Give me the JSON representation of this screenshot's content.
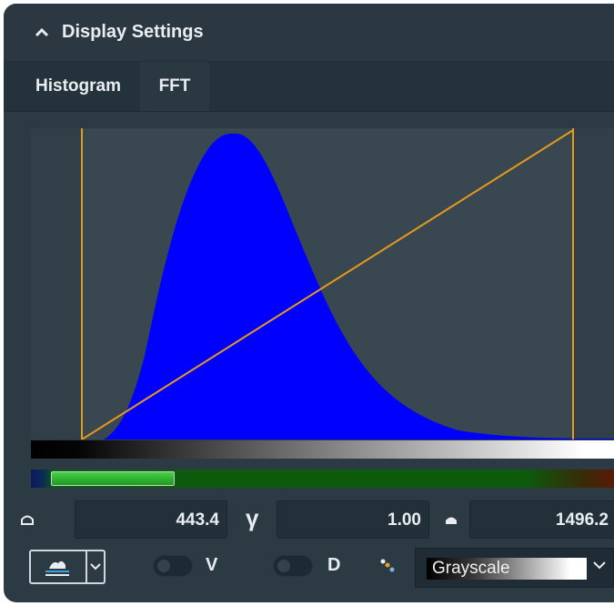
{
  "header": {
    "title": "Display Settings",
    "collapse_icon": "chevron-up-icon"
  },
  "tabs": [
    {
      "label": "Histogram"
    },
    {
      "label": "FFT"
    }
  ],
  "levels": {
    "low_value": "443.4",
    "gamma_symbol": "γ",
    "gamma_value": "1.00",
    "high_value": "1496.2"
  },
  "controls": {
    "mode_icon": "layer-compare-icon",
    "toggle_v_label": "V",
    "toggle_d_label": "D",
    "colormap_icon": "palette-icon",
    "colormap": "Grayscale"
  },
  "colors": {
    "panel_bg": "#2c3a43",
    "histogram_fill": "#0000ff",
    "transfer_line": "#e59a1b",
    "accent_green": "#35c235"
  }
}
